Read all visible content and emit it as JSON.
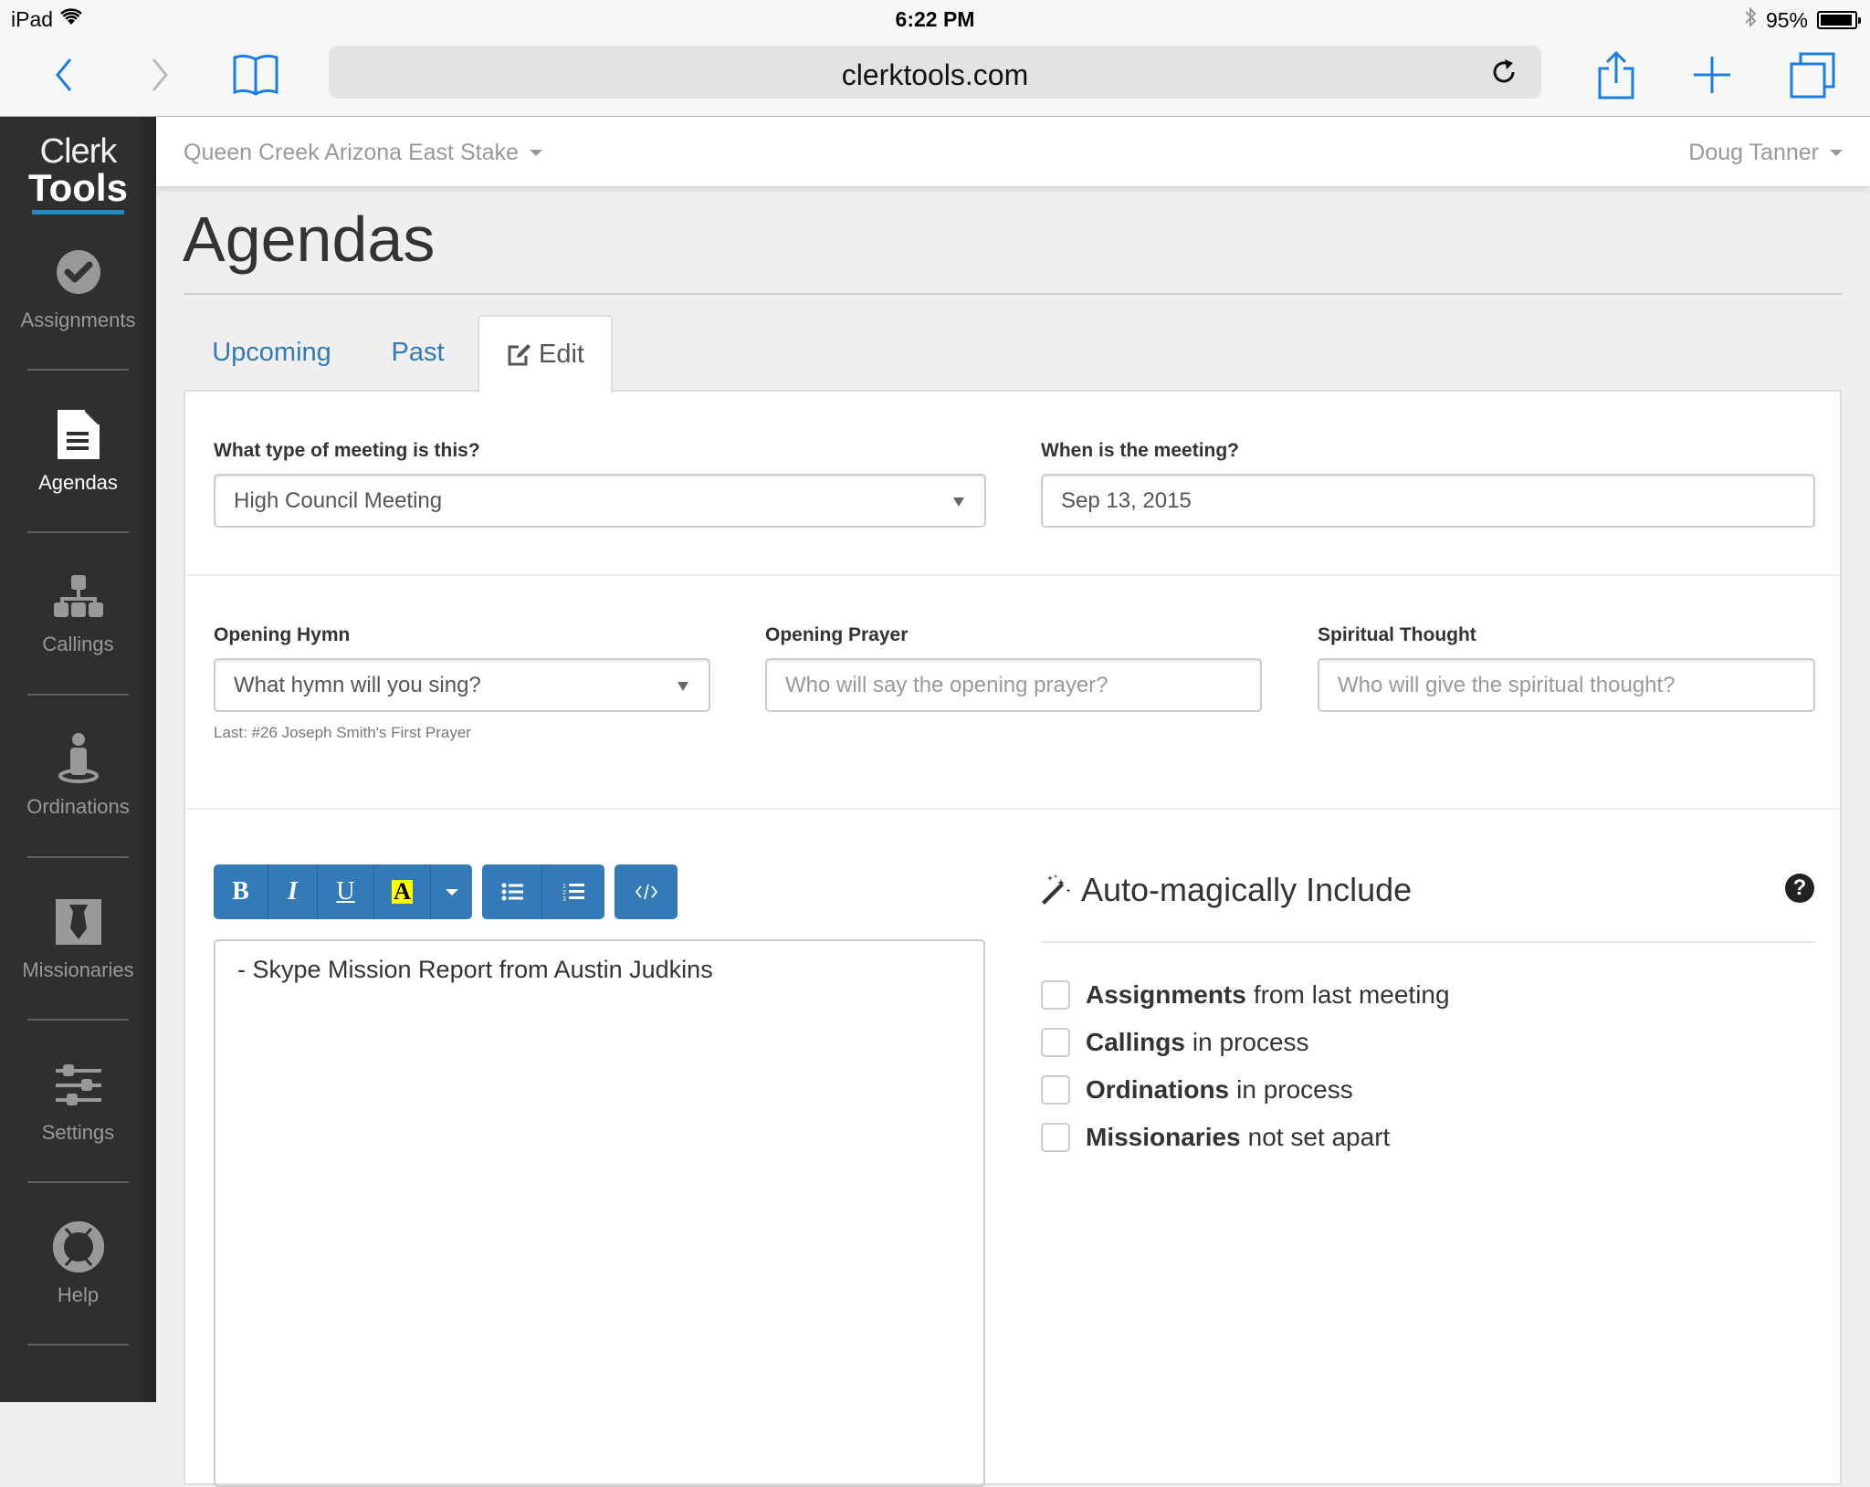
{
  "status_bar": {
    "device": "iPad",
    "time": "6:22 PM",
    "battery_percent": "95%",
    "battery_level": 0.95
  },
  "browser": {
    "url": "clerktools.com",
    "icons": {
      "back": "chevron-left-icon",
      "forward": "chevron-right-icon",
      "bookmarks": "book-icon",
      "reload": "reload-icon",
      "share": "share-icon",
      "new_tab": "plus-icon",
      "tabs": "tabs-icon"
    }
  },
  "logo": {
    "line1": "Clerk",
    "line2": "Tools"
  },
  "sidebar": {
    "items": [
      {
        "label": "Assignments",
        "icon": "check-circle-icon",
        "active": false
      },
      {
        "label": "Agendas",
        "icon": "document-icon",
        "active": true
      },
      {
        "label": "Callings",
        "icon": "org-chart-icon",
        "active": false
      },
      {
        "label": "Ordinations",
        "icon": "person-icon",
        "active": false
      },
      {
        "label": "Missionaries",
        "icon": "tie-icon",
        "active": false
      },
      {
        "label": "Settings",
        "icon": "sliders-icon",
        "active": false
      },
      {
        "label": "Help",
        "icon": "lifebuoy-icon",
        "active": false
      }
    ]
  },
  "topnav": {
    "stake": "Queen Creek Arizona East Stake",
    "user": "Doug Tanner"
  },
  "page": {
    "title": "Agendas",
    "tabs": [
      {
        "label": "Upcoming",
        "active": false
      },
      {
        "label": "Past",
        "active": false
      },
      {
        "label": "Edit",
        "active": true
      }
    ]
  },
  "form": {
    "meeting_type": {
      "label": "What type of meeting is this?",
      "value": "High Council Meeting"
    },
    "meeting_date": {
      "label": "When is the meeting?",
      "value": "Sep 13, 2015"
    },
    "opening_hymn": {
      "label": "Opening Hymn",
      "placeholder": "What hymn will you sing?",
      "hint": "Last: #26 Joseph Smith's First Prayer"
    },
    "opening_prayer": {
      "label": "Opening Prayer",
      "placeholder": "Who will say the opening prayer?"
    },
    "spiritual_thought": {
      "label": "Spiritual Thought",
      "placeholder": "Who will give the spiritual thought?"
    }
  },
  "editor": {
    "toolbar": {
      "bold": "B",
      "italic": "I",
      "underline": "U",
      "highlight": "A",
      "highlight_color": "#ffff00"
    },
    "content": "- Skype Mission Report from Austin Judkins"
  },
  "auto_include": {
    "title": "Auto-magically Include",
    "options": [
      {
        "bold": "Assignments",
        "rest": "from last meeting",
        "checked": false
      },
      {
        "bold": "Callings",
        "rest": "in process",
        "checked": false
      },
      {
        "bold": "Ordinations",
        "rest": "in process",
        "checked": false
      },
      {
        "bold": "Missionaries",
        "rest": "not set apart",
        "checked": false
      }
    ]
  },
  "colors": {
    "primary": "#337ab7",
    "sidebar_bg": "#2f2f2f",
    "logo_accent": "#1d8fc2",
    "ios_blue": "#1a7ee0"
  }
}
